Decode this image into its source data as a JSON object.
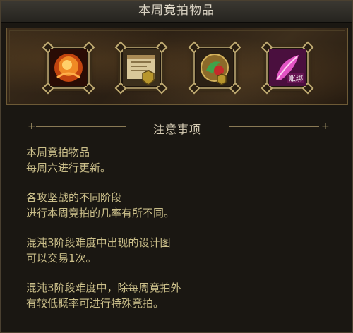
{
  "window": {
    "title": "本周竟拍物品"
  },
  "items": [
    {
      "icon": "fire-gem-icon",
      "color": "#e0621c"
    },
    {
      "icon": "blueprint-scroll-icon",
      "color": "#c9b07a"
    },
    {
      "icon": "green-red-emblem-icon",
      "color": "#3fa24a"
    },
    {
      "icon": "pink-feather-tag-icon",
      "color": "#d63fb7",
      "tag": "账绑"
    }
  ],
  "section": {
    "title": "注意事项",
    "plus": "+"
  },
  "notes": [
    {
      "lines": "本周竟拍物品\n每周六进行更新。"
    },
    {
      "lines": "各攻坚战的不同阶段\n进行本周竟拍的几率有所不同。"
    },
    {
      "lines": "混沌3阶段难度中出现的设计图\n可以交易1次。"
    },
    {
      "lines": "混沌3阶段难度中，除每周竟拍外\n有较低概率可进行特殊竟拍。"
    }
  ]
}
